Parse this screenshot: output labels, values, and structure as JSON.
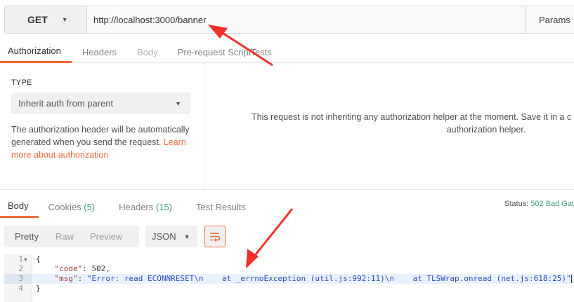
{
  "request": {
    "method": "GET",
    "url": "http://localhost:3000/banner",
    "params_label": "Params"
  },
  "request_tabs": [
    "Authorization",
    "Headers",
    "Body",
    "Pre-request Script",
    "Tests"
  ],
  "auth": {
    "type_label": "TYPE",
    "type_value": "Inherit auth from parent",
    "description": "The authorization header will be automatically generated when you send the request.",
    "learn_more": "Learn more about authorization",
    "message_line1": "This request is not inheriting any authorization helper at the moment. Save it in a c",
    "message_line2": "authorization helper."
  },
  "response_tabs": {
    "body": "Body",
    "cookies": "Cookies",
    "cookies_count": "(5)",
    "headers": "Headers",
    "headers_count": "(15)",
    "test_results": "Test Results"
  },
  "status": {
    "label": "Status:",
    "value": "502 Bad Gat"
  },
  "format": {
    "pretty": "Pretty",
    "raw": "Raw",
    "preview": "Preview",
    "language": "JSON"
  },
  "code": {
    "line_numbers": [
      "1",
      "2",
      "3",
      "4"
    ],
    "open_brace": "{",
    "code_key": "\"code\"",
    "code_value": "502",
    "msg_key": "\"msg\"",
    "msg_value": "\"Error: read ECONNRESET\\n    at _errnoException (util.js:992:11)\\n    at TLSWrap.onread (net.js:618:25)\"",
    "close_brace": "}"
  },
  "colors": {
    "accent": "#f26b3a",
    "status_green": "#3ea37a",
    "annotation_arrow": "#f0302a"
  },
  "icons": {
    "method_dropdown": "chevron-down-icon",
    "type_dropdown": "chevron-down-icon",
    "language_dropdown": "chevron-down-icon",
    "wrap": "wrap-lines-icon",
    "fold": "fold-arrow-icon"
  }
}
